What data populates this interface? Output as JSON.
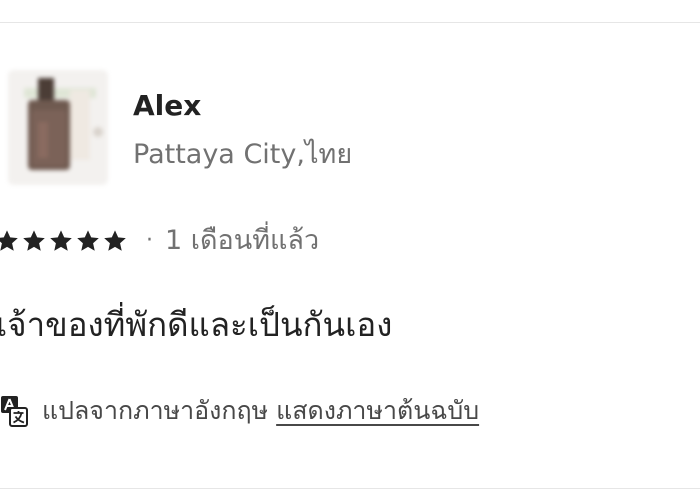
{
  "review": {
    "reviewer": {
      "name": "Alex",
      "location": "Pattaya City,ไทย",
      "avatar_icon": "reviewer-avatar-photo"
    },
    "rating": {
      "stars": 5,
      "max_stars": 5,
      "separator": "·",
      "time_ago": "1 เดือนที่แล้ว"
    },
    "text": "เจ้าของที่พักดีและเป็นกันเอง",
    "translation": {
      "icon": "translate-icon",
      "note": "แปลจากภาษาอังกฤษ",
      "show_original_label": "แสดงภาษาต้นฉบับ"
    }
  },
  "colors": {
    "primary_text": "#222222",
    "secondary_text": "#717171",
    "star": "#222222",
    "divider": "#e6e6e6"
  }
}
